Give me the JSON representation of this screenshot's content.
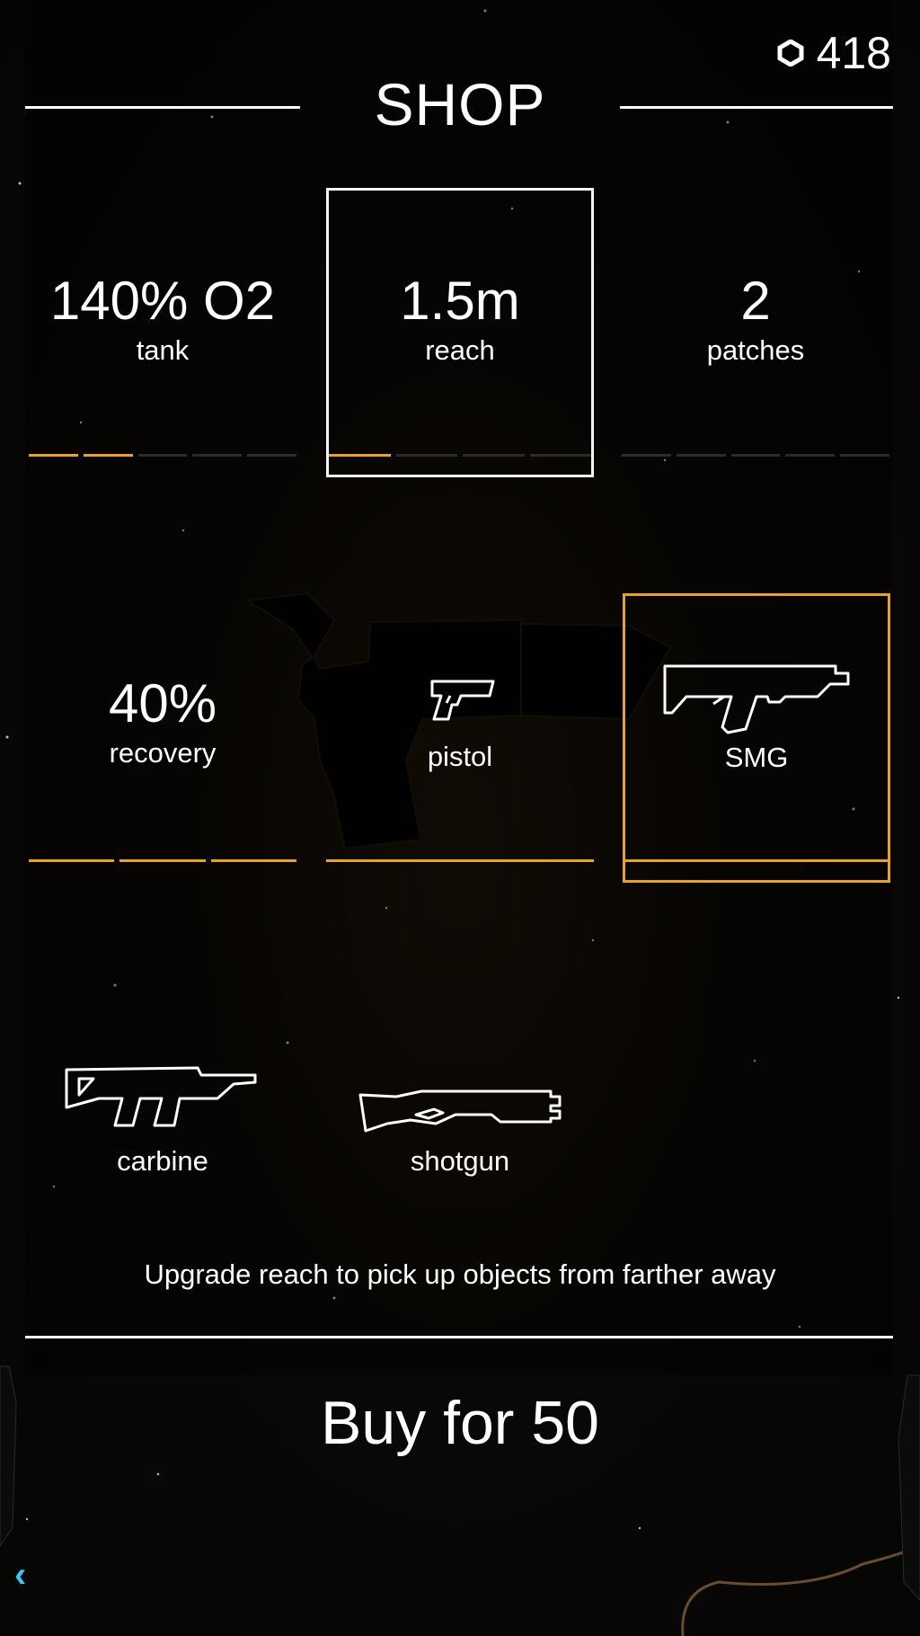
{
  "header": {
    "title": "SHOP",
    "currency_amount": "418",
    "currency_icon": "hexagon-coin-icon"
  },
  "upgrades": [
    {
      "value": "140% O2",
      "label": "tank",
      "levels_owned": 2,
      "levels_total": 5
    },
    {
      "value": "1.5m",
      "label": "reach",
      "levels_owned": 1,
      "levels_total": 4,
      "selected": true
    },
    {
      "value": "2",
      "label": "patches",
      "levels_owned": 0,
      "levels_total": 5
    },
    {
      "value": "40%",
      "label": "recovery",
      "levels_owned": 3,
      "levels_total": 3
    }
  ],
  "weapons": [
    {
      "label": "pistol",
      "icon": "pistol-icon",
      "owned": true
    },
    {
      "label": "SMG",
      "icon": "smg-icon",
      "owned": true,
      "equipped": true
    },
    {
      "label": "carbine",
      "icon": "carbine-icon"
    },
    {
      "label": "shotgun",
      "icon": "shotgun-icon"
    }
  ],
  "description": "Upgrade reach to pick up objects from farther away",
  "buy_label": "Buy for 50",
  "colors": {
    "accent": "#e8a22a",
    "inactive_bar": "#2b2b2b",
    "back_arrow": "#3ec6ff"
  },
  "back_icon": "back-arrow-icon"
}
